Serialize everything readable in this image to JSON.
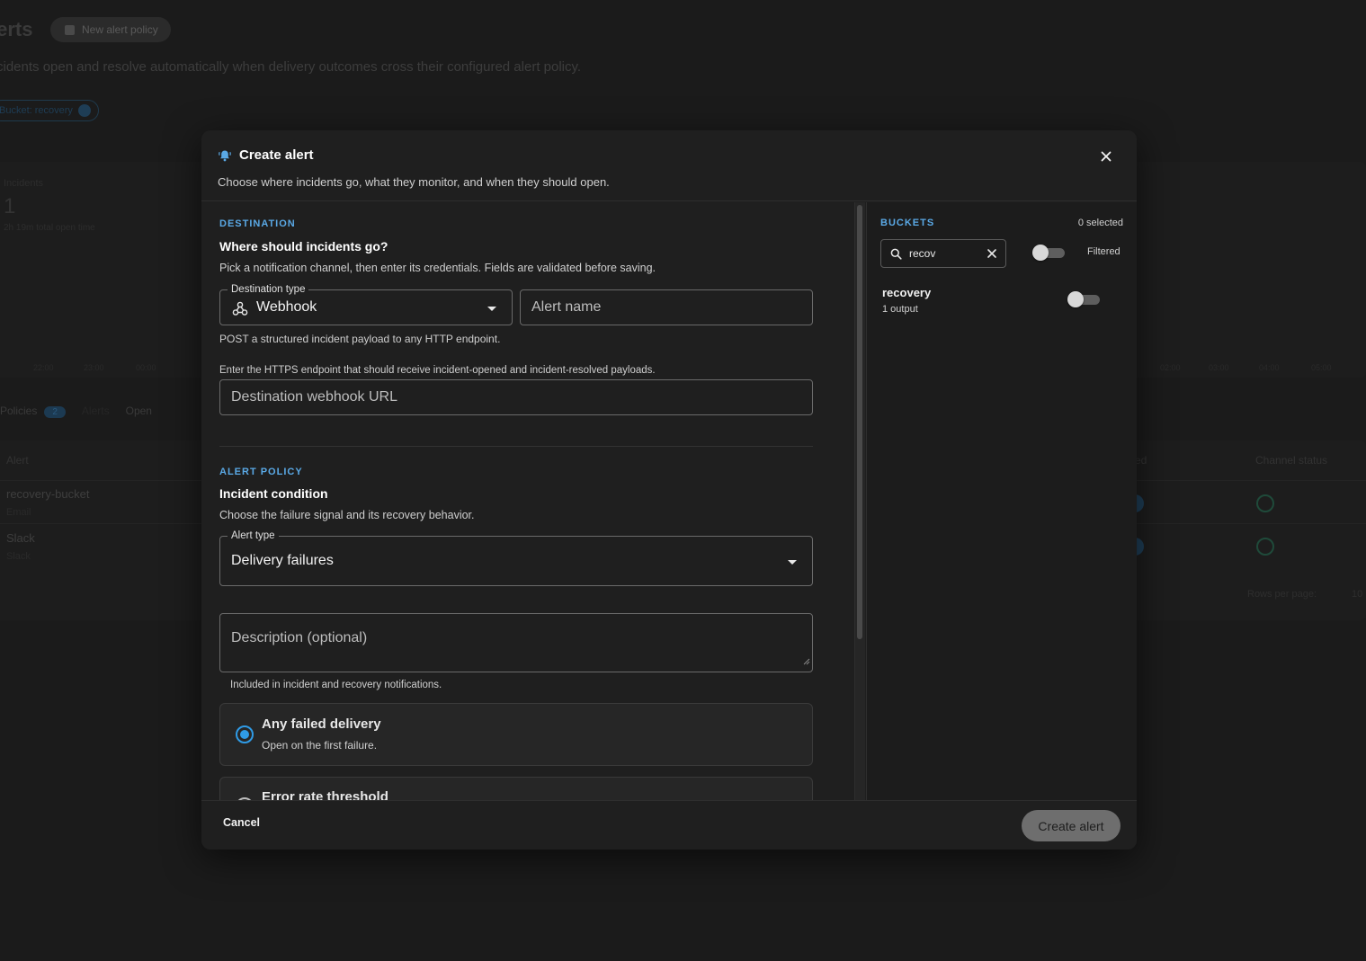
{
  "background": {
    "page_title": "lerts",
    "new_policy_button": "New alert policy",
    "subtitle": "cidents open and resolve automatically when delivery outcomes cross their configured alert policy.",
    "filter_chip": "Bucket: recovery",
    "incidents_label": "Incidents",
    "incidents_value": "1",
    "incidents_sub": "2h 19m total open time",
    "axis_ticks": [
      "22:00",
      "23:00",
      "00:00",
      "01:00",
      "02:00",
      "03:00",
      "04:00",
      "05:00"
    ],
    "tabs": [
      {
        "label": "Policies",
        "badge": "2"
      },
      {
        "label": "Alerts"
      },
      {
        "label": "Open"
      }
    ],
    "table_headers": {
      "alert": "Alert",
      "enabled": "ed",
      "channel_status": "Channel status"
    },
    "rows": [
      {
        "name": "recovery-bucket",
        "sub": "Email"
      },
      {
        "name": "Slack",
        "sub": "Slack"
      }
    ],
    "rows_per_page_label": "Rows per page:",
    "rows_per_page_value": "10"
  },
  "dialog": {
    "title": "Create alert",
    "description": "Choose where incidents go, what they monitor, and when they should open.",
    "destination": {
      "section_label": "DESTINATION",
      "title": "Where should incidents go?",
      "description": "Pick a notification channel, then enter its credentials. Fields are validated before saving.",
      "type_legend": "Destination type",
      "type_value": "Webhook",
      "alert_name_placeholder": "Alert name",
      "type_helper": "POST a structured incident payload to any HTTP endpoint.",
      "url_helper": "Enter the HTTPS endpoint that should receive incident-opened and incident-resolved payloads.",
      "url_placeholder": "Destination webhook URL"
    },
    "policy": {
      "section_label": "ALERT POLICY",
      "title": "Incident condition",
      "description": "Choose the failure signal and its recovery behavior.",
      "alert_type_legend": "Alert type",
      "alert_type_value": "Delivery failures",
      "description_placeholder": "Description (optional)",
      "description_helper": "Included in incident and recovery notifications.",
      "options": [
        {
          "title": "Any failed delivery",
          "subtitle": "Open on the first failure.",
          "selected": true
        },
        {
          "title": "Error rate threshold",
          "subtitle": "",
          "selected": false
        }
      ]
    },
    "buckets": {
      "label": "BUCKETS",
      "selected_count": "0 selected",
      "search_value": "recov",
      "filtered_label": "Filtered",
      "filtered_on": false,
      "items": [
        {
          "name": "recovery",
          "sub": "1 output",
          "enabled": false
        }
      ]
    },
    "footer": {
      "cancel_label": "Cancel",
      "create_label": "Create alert"
    },
    "colors": {
      "accent": "#5aa9e6",
      "radio": "#2f9be6",
      "create_button": "#6e6e6e"
    }
  }
}
